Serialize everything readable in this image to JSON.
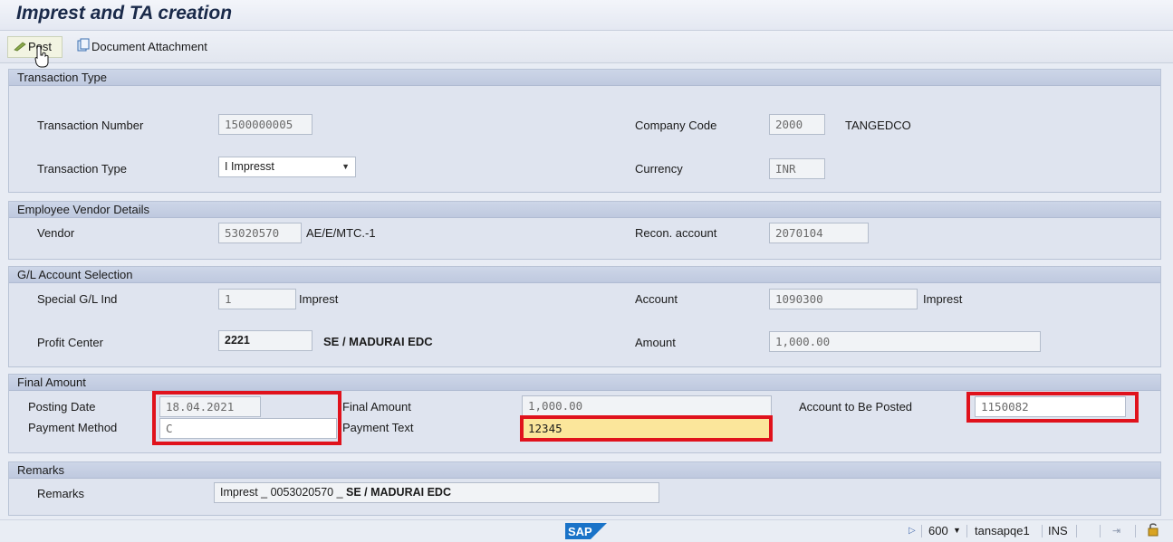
{
  "window": {
    "title": "Imprest and TA creation"
  },
  "toolbar": {
    "post_label": "Post",
    "attach_label": "Document Attachment"
  },
  "transaction_type": {
    "header": "Transaction Type",
    "number_label": "Transaction Number",
    "number_value": "1500000005",
    "type_label": "Transaction Type",
    "type_value": "I Impresst",
    "company_code_label": "Company Code",
    "company_code_value": "2000",
    "company_name": "TANGEDCO",
    "currency_label": "Currency",
    "currency_value": "INR"
  },
  "employee_vendor": {
    "header": "Employee Vendor Details",
    "vendor_label": "Vendor",
    "vendor_value": "53020570",
    "vendor_name": "AE/E/MTC.-1",
    "recon_label": "Recon. account",
    "recon_value": "2070104"
  },
  "gl_account": {
    "header": "G/L Account Selection",
    "special_gl_label": "Special G/L Ind",
    "special_gl_value": "1",
    "special_gl_text": "Imprest",
    "account_label": "Account",
    "account_value": "1090300",
    "account_text": "Imprest",
    "profit_center_label": "Profit Center",
    "profit_center_value": "2221",
    "profit_center_text": "SE / MADURAI EDC",
    "amount_label": "Amount",
    "amount_value": "1,000.00"
  },
  "final_amount": {
    "header": "Final Amount",
    "posting_date_label": "Posting Date",
    "posting_date_value": "18.04.2021",
    "payment_method_label": "Payment Method",
    "payment_method_value": "C",
    "final_amount_label": "Final Amount",
    "final_amount_value": "1,000.00",
    "payment_text_label": "Payment Text",
    "payment_text_value": "12345",
    "account_posted_label": "Account to Be Posted",
    "account_posted_value": "1150082"
  },
  "remarks": {
    "header": "Remarks",
    "label": "Remarks",
    "value_prefix": "Imprest _ 0053020570 _ ",
    "value_bold": "SE / MADURAI EDC"
  },
  "status_bar": {
    "logo": "SAP",
    "client": "600",
    "server": "tansapqe1",
    "mode": "INS"
  },
  "colors": {
    "highlight_box": "#e0121c",
    "active_field": "#fbe69b",
    "sap_blue": "#1a73c8"
  }
}
